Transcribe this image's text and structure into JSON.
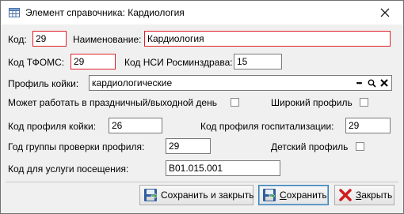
{
  "window": {
    "title": "Элемент справочника: Кардиология"
  },
  "fields": {
    "code": {
      "label": "Код:",
      "value": "29"
    },
    "name": {
      "label": "Наименование:",
      "value": "Кардиология"
    },
    "tfoms_code": {
      "label": "Код ТФОМС:",
      "value": "29"
    },
    "nsi_code": {
      "label": "Код НСИ Росминздрава:",
      "value": "15"
    },
    "bed_profile": {
      "label": "Профиль койки:",
      "value": "кардиологические",
      "more_label": "•••"
    },
    "holiday_work": {
      "label": "Может работать в праздничный/выходной день",
      "checked": false
    },
    "wide_profile": {
      "label": "Широкий профиль",
      "checked": false
    },
    "bed_profile_code": {
      "label": "Код профиля койки:",
      "value": "26"
    },
    "hosp_profile_code": {
      "label": "Код профиля госпитализации:",
      "value": "29"
    },
    "check_year": {
      "label": "Год группы проверки профиля:",
      "value": "29"
    },
    "child_profile": {
      "label": "Детский профиль",
      "checked": false
    },
    "visit_service_code": {
      "label": "Код для услуги посещения:",
      "value": "B01.015.001"
    }
  },
  "buttons": {
    "save_close": {
      "label": "Сохранить и закрыть"
    },
    "save": {
      "label_first": "С",
      "label_rest": "охранить"
    },
    "close": {
      "label_first": "З",
      "label_rest": "акрыть"
    }
  },
  "colors": {
    "required_border": "#e0202a",
    "window_bg": "#f0f0f0",
    "default_button_border": "#3c7fb1"
  }
}
